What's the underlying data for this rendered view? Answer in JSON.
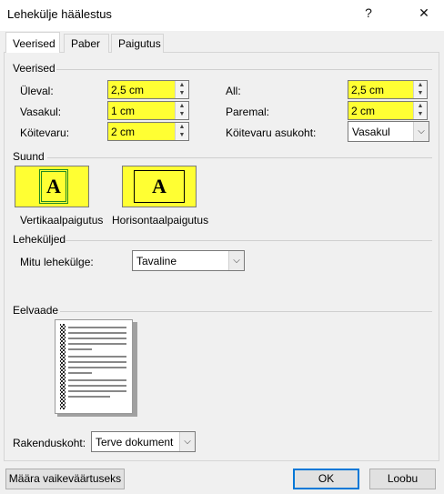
{
  "window": {
    "title": "Lehekülje häälestus",
    "help_glyph": "?",
    "close_glyph": "✕"
  },
  "tabs": [
    {
      "label": "Veerised",
      "active": true
    },
    {
      "label": "Paber",
      "active": false
    },
    {
      "label": "Paigutus",
      "active": false
    }
  ],
  "margins": {
    "section_label": "Veerised",
    "top": {
      "label": "Üleval:",
      "value": "2,5 cm"
    },
    "bottom": {
      "label": "All:",
      "value": "2,5 cm"
    },
    "left": {
      "label": "Vasakul:",
      "value": "1 cm"
    },
    "right": {
      "label": "Paremal:",
      "value": "2 cm"
    },
    "gutter": {
      "label": "Köitevaru:",
      "value": "2 cm"
    },
    "gutter_position": {
      "label": "Köitevaru asukoht:",
      "value": "Vasakul"
    }
  },
  "orientation": {
    "section_label": "Suund",
    "portrait": {
      "label": "Vertikaalpaigutus",
      "glyph": "A",
      "selected": true
    },
    "landscape": {
      "label": "Horisontaalpaigutus",
      "glyph": "A",
      "selected": false
    }
  },
  "pages": {
    "section_label": "Leheküljed",
    "multiple_pages": {
      "label": "Mitu lehekülge:",
      "value": "Tavaline"
    }
  },
  "preview": {
    "section_label": "Eelvaade",
    "apply_to": {
      "label": "Rakenduskoht:",
      "value": "Terve dokument"
    }
  },
  "buttons": {
    "set_default": "Määra vaikeväärtuseks",
    "ok": "OK",
    "cancel": "Loobu"
  },
  "colors": {
    "highlight": "#ffff33",
    "accent": "#0078d7"
  },
  "icons": {
    "spin_up": "▲",
    "spin_down": "▼",
    "dropdown": "⌵"
  }
}
